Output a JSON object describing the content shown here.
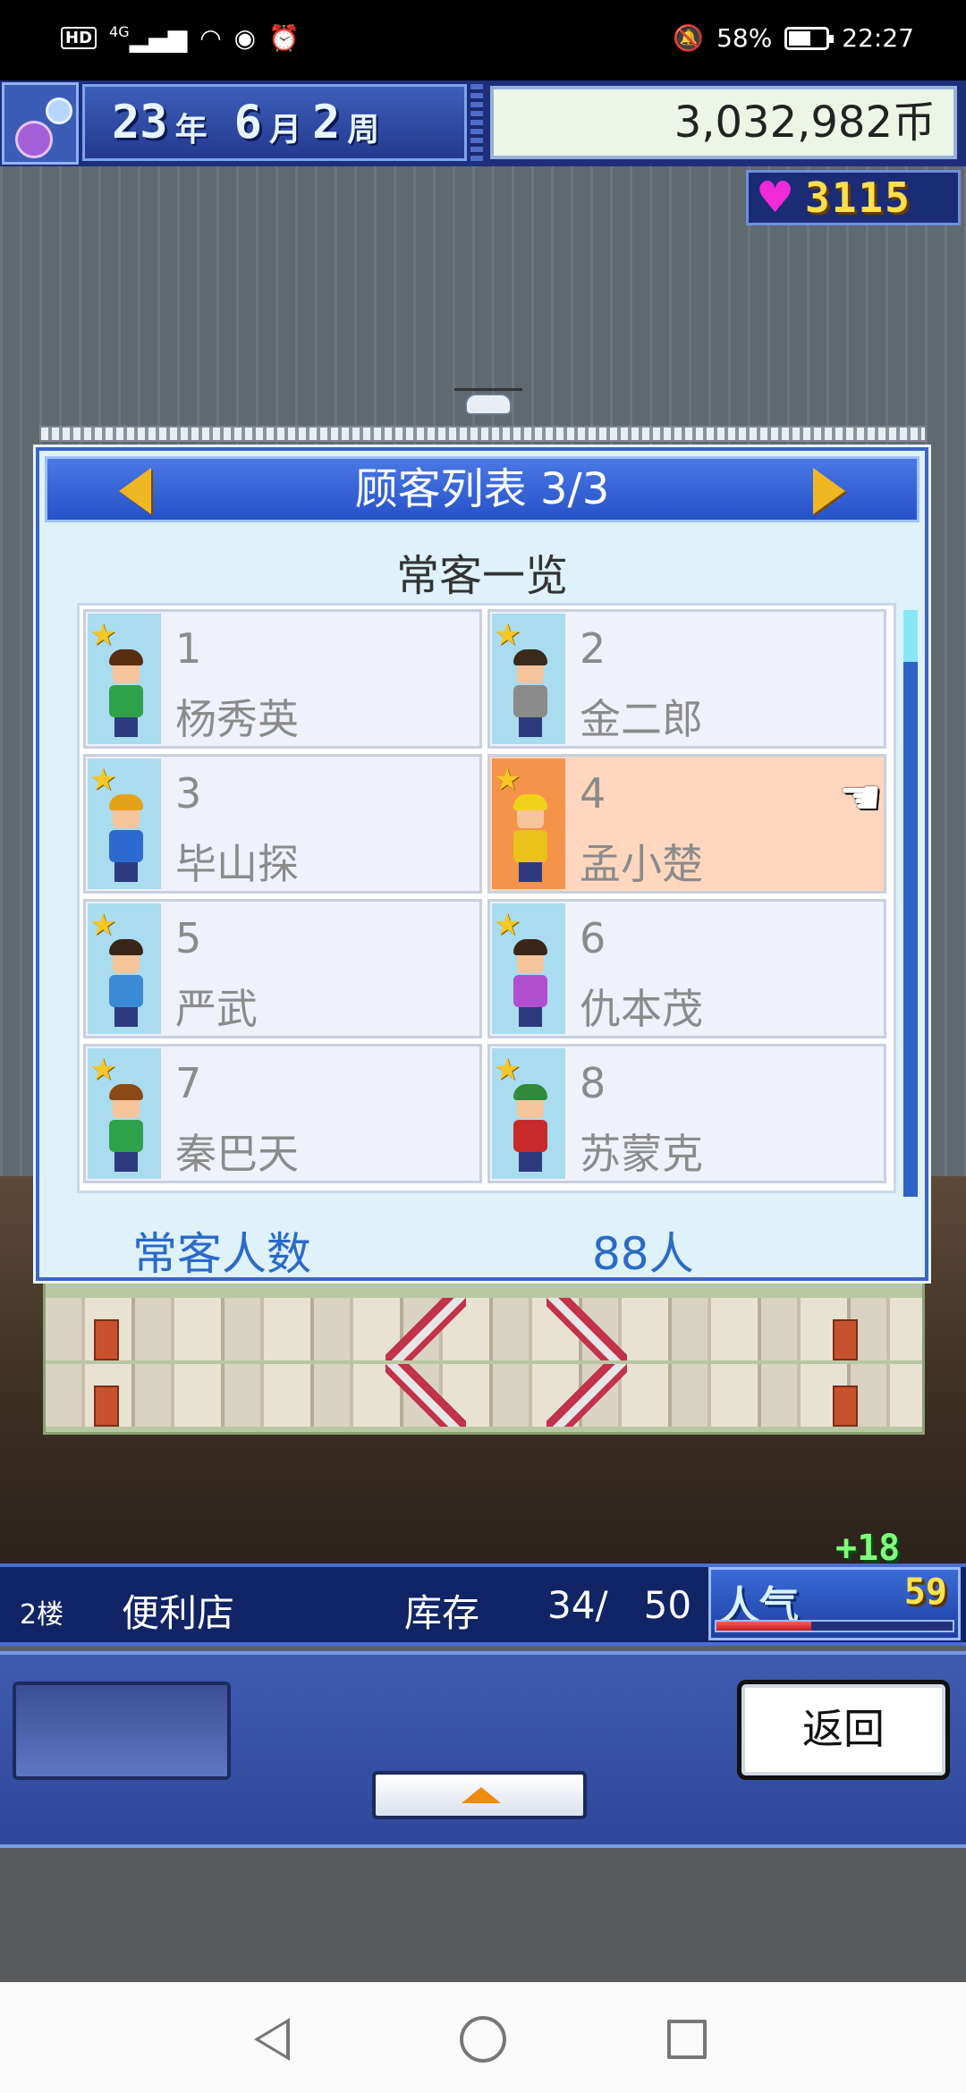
{
  "status_bar": {
    "left_icons": [
      "hd-icon",
      "signal-4g-icon",
      "wifi-icon",
      "eye-icon",
      "alarm-icon"
    ],
    "network_label": "4G",
    "hd_label": "HD",
    "battery_percent": "58%",
    "time": "22:27"
  },
  "header": {
    "year": "23",
    "year_unit": "年",
    "month": "6",
    "month_unit": "月",
    "week": "2",
    "week_unit": "周",
    "money": "3,032,982币",
    "love_points": "3115"
  },
  "dialog": {
    "title": "顾客列表 3/3",
    "subtitle": "常客一览",
    "customers": [
      {
        "num": "1",
        "name": "杨秀英",
        "hair": "#5a2c10",
        "shirt": "#2fa14a",
        "selected": false
      },
      {
        "num": "2",
        "name": "金二郎",
        "hair": "#3a2a1a",
        "shirt": "#8a8a8a",
        "selected": false
      },
      {
        "num": "3",
        "name": "毕山探",
        "hair": "#e3a21a",
        "shirt": "#2d6ad0",
        "selected": false
      },
      {
        "num": "4",
        "name": "孟小楚",
        "hair": "#f1d21a",
        "shirt": "#e8c21a",
        "selected": true
      },
      {
        "num": "5",
        "name": "严武",
        "hair": "#3a2616",
        "shirt": "#3a8ad6",
        "selected": false
      },
      {
        "num": "6",
        "name": "仇本茂",
        "hair": "#3a2616",
        "shirt": "#b14fd0",
        "selected": false
      },
      {
        "num": "7",
        "name": "秦巴天",
        "hair": "#8a4a16",
        "shirt": "#2fa14a",
        "selected": false
      },
      {
        "num": "8",
        "name": "苏蒙克",
        "hair": "#2f8a3a",
        "shirt": "#c82a2a",
        "selected": false
      }
    ],
    "footer_label": "常客人数",
    "footer_value": "88人"
  },
  "info_bar": {
    "floor": "2楼",
    "shop_name": "便利店",
    "stock_label": "库存",
    "stock_count": "34/   50",
    "popularity_label": "人气",
    "popularity_value": "59",
    "popularity_delta": "+18",
    "popularity_fraction": 0.4
  },
  "controls": {
    "back_label": "返回"
  }
}
